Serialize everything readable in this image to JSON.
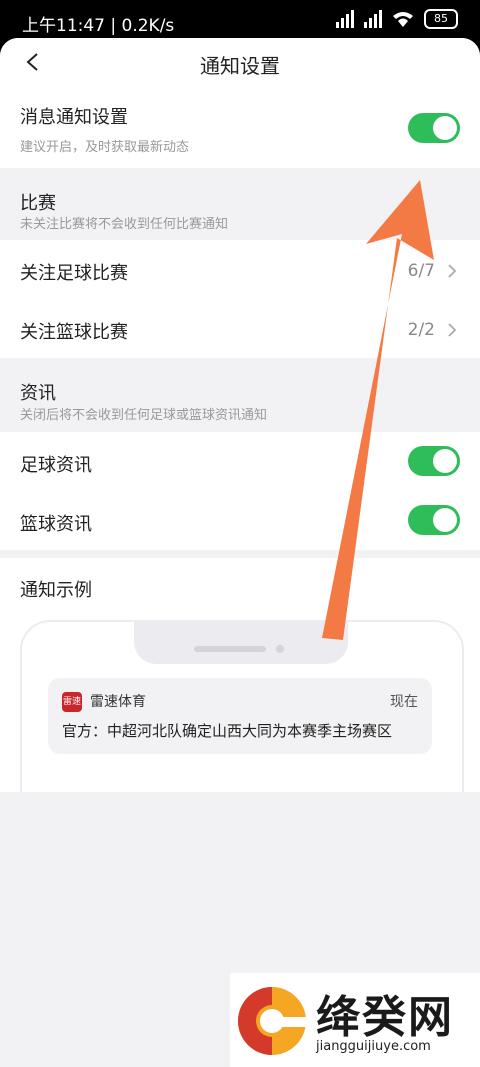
{
  "status_bar": {
    "time": "上午11:47 | 0.2K/s",
    "battery": "85"
  },
  "nav": {
    "title": "通知设置"
  },
  "message_settings": {
    "title": "消息通知设置",
    "subtitle": "建议开启，及时获取最新动态",
    "toggle_on": true
  },
  "match_section": {
    "title": "比赛",
    "subtitle": "未关注比赛将不会收到任何比赛通知",
    "items": [
      {
        "label": "关注足球比赛",
        "count": "6/7"
      },
      {
        "label": "关注篮球比赛",
        "count": "2/2"
      }
    ]
  },
  "news_section": {
    "title": "资讯",
    "subtitle": "关闭后将不会收到任何足球或篮球资讯通知",
    "items": [
      {
        "label": "足球资讯",
        "toggle_on": true
      },
      {
        "label": "篮球资讯",
        "toggle_on": true
      }
    ]
  },
  "example": {
    "title": "通知示例",
    "app_logo": "雷速",
    "app_name": "雷速体育",
    "time": "现在",
    "text": "官方：中超河北队确定山西大同为本赛季主场赛区"
  },
  "watermark": {
    "name": "绛癸网",
    "url": "jiangguijiuye.com"
  },
  "colors": {
    "toggle_green": "#2ebd59",
    "arrow_orange": "#f47a45",
    "background": "#f2f2f4"
  }
}
